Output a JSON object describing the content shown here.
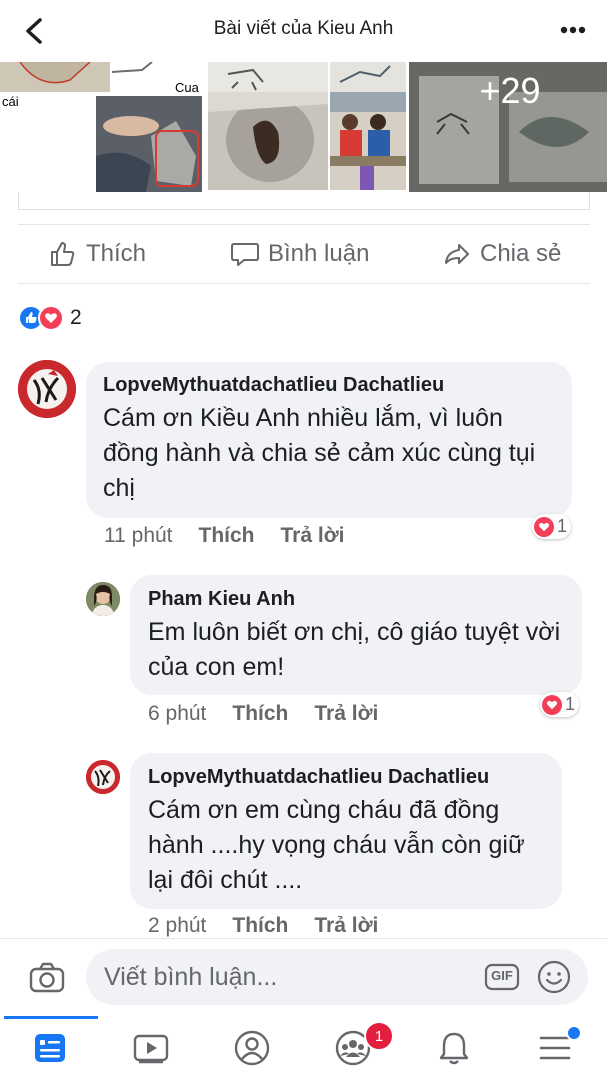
{
  "header": {
    "title": "Bài viết của Kieu Anh",
    "back_icon": "chevron-left-icon",
    "more_icon": "more-horizontal-icon"
  },
  "photos": {
    "label_left": "cái",
    "label_cua": "Cua",
    "more_count": "+29"
  },
  "actions": {
    "like": "Thích",
    "comment": "Bình luận",
    "share": "Chia sẻ"
  },
  "reactions": {
    "count": "2",
    "types": [
      "like-icon",
      "love-icon"
    ]
  },
  "comments": [
    {
      "author": "LopveMythuatdachatlieu Dachatlieu",
      "text": "Cám ơn Kiều Anh nhiều lắm, vì luôn đồng hành và chia sẻ cảm xúc cùng tụi chị",
      "time": "11 phút",
      "like": "Thích",
      "reply": "Trả lời",
      "reaction_count": "1"
    },
    {
      "author": "Pham Kieu Anh",
      "text": "Em luôn biết ơn chị, cô giáo tuyệt vời của con em!",
      "time": "6 phút",
      "like": "Thích",
      "reply": "Trả lời",
      "reaction_count": "1"
    },
    {
      "author": "LopveMythuatdachatlieu Dachatlieu",
      "text": "Cám ơn em cùng cháu đã đồng hành ....hy vọng cháu vẫn còn giữ lại đôi chút ....",
      "time": "2 phút",
      "like": "Thích",
      "reply": "Trả lời"
    }
  ],
  "composer": {
    "placeholder": "Viết bình luận...",
    "gif_label": "GIF"
  },
  "tabbar": {
    "notification_badge": "1",
    "tabs": [
      "news-feed-icon",
      "watch-icon",
      "profile-icon",
      "groups-icon",
      "bell-icon",
      "menu-icon"
    ]
  },
  "colors": {
    "accent": "#1877f2",
    "love": "#f33e58",
    "badge": "#e41e3f",
    "bubble": "#f0f2f5",
    "meta": "#65676b"
  }
}
